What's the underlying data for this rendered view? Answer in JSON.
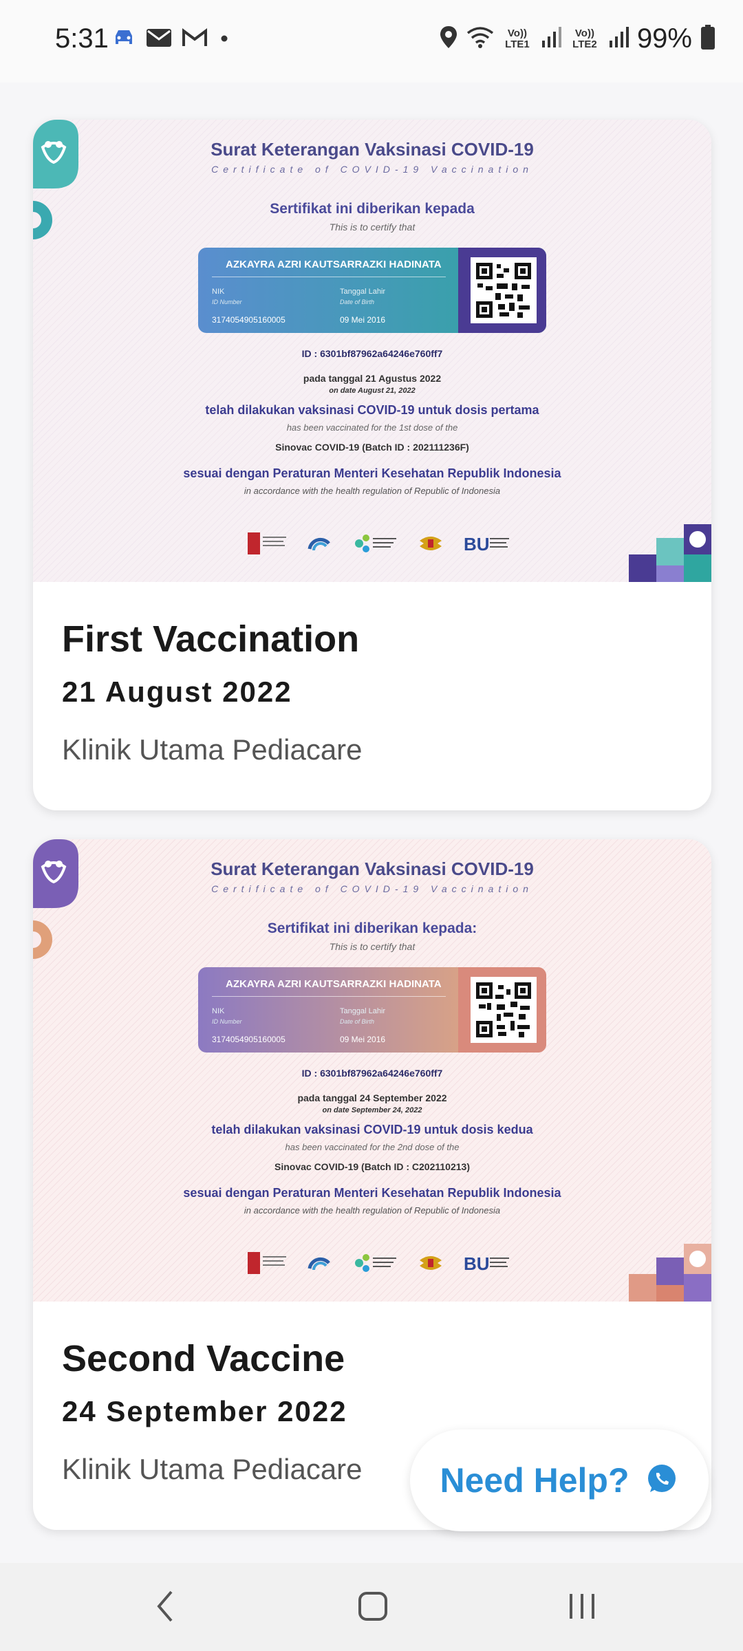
{
  "status_bar": {
    "time": "5:31",
    "battery_pct": "99%",
    "net1": "Vo)) LTE1",
    "net2": "Vo)) LTE2",
    "icons": [
      "car-icon",
      "mail-icon",
      "gmail-icon",
      "dot-icon",
      "location-icon",
      "wifi-icon",
      "signal-icon",
      "battery-icon"
    ]
  },
  "certificates": [
    {
      "cert_title": "Surat Keterangan Vaksinasi COVID-19",
      "cert_subtitle": "Certificate of COVID-19 Vaccination",
      "given_to": "Sertifikat ini diberikan kepada",
      "certify_en": "This is to certify that",
      "name": "AZKAYRA AZRI KAUTSARRAZKI HADINATA",
      "nik_label": "NIK",
      "nik_label_en": "ID Number",
      "nik": "3174054905160005",
      "dob_label": "Tanggal Lahir",
      "dob_label_en": "Date of Birth",
      "dob": "09 Mei 2016",
      "id": "ID : 6301bf87962a64246e760ff7",
      "date_id": "pada tanggal 21 Agustus 2022",
      "date_en": "on date August 21, 2022",
      "dose_id": "telah dilakukan vaksinasi COVID-19 untuk dosis pertama",
      "dose_en": "has been vaccinated for the 1st dose of the",
      "batch": "Sinovac COVID-19 (Batch ID : 202111236F)",
      "reg_id": "sesuai dengan Peraturan Menteri Kesehatan Republik Indonesia",
      "reg_en": "in accordance with the health regulation of Republic of Indonesia",
      "card_title": "First Vaccination",
      "card_date": "21 August 2022",
      "card_clinic": "Klinik Utama Pediacare"
    },
    {
      "cert_title": "Surat Keterangan Vaksinasi COVID-19",
      "cert_subtitle": "Certificate of COVID-19 Vaccination",
      "given_to": "Sertifikat ini diberikan kepada:",
      "certify_en": "This is to certify that",
      "name": "AZKAYRA AZRI KAUTSARRAZKI HADINATA",
      "nik_label": "NIK",
      "nik_label_en": "ID Number",
      "nik": "3174054905160005",
      "dob_label": "Tanggal Lahir",
      "dob_label_en": "Date of Birth",
      "dob": "09 Mei 2016",
      "id": "ID : 6301bf87962a64246e760ff7",
      "date_id": "pada tanggal 24 September 2022",
      "date_en": "on date September 24, 2022",
      "dose_id": "telah dilakukan vaksinasi COVID-19 untuk dosis kedua",
      "dose_en": "has been vaccinated for the 2nd dose of the",
      "batch": "Sinovac COVID-19 (Batch ID : C202110213)",
      "reg_id": "sesuai dengan Peraturan Menteri Kesehatan Republik Indonesia",
      "reg_en": "in accordance with the health regulation of Republic of Indonesia",
      "card_title": "Second Vaccine",
      "card_date": "24 September 2022",
      "card_clinic": "Klinik Utama Pediacare"
    }
  ],
  "logos": [
    "KPC PEN",
    "KOMINFO",
    "KEMENTERIAN KESEHATAN REPUBLIK INDONESIA",
    "GARUDA",
    "BUMN"
  ],
  "help_button": {
    "label": "Need Help?",
    "icon": "whatsapp-icon",
    "color": "#2a8ed6"
  },
  "nav": {
    "back_icon": "back-icon",
    "home_icon": "home-icon",
    "recents_icon": "recents-icon"
  }
}
